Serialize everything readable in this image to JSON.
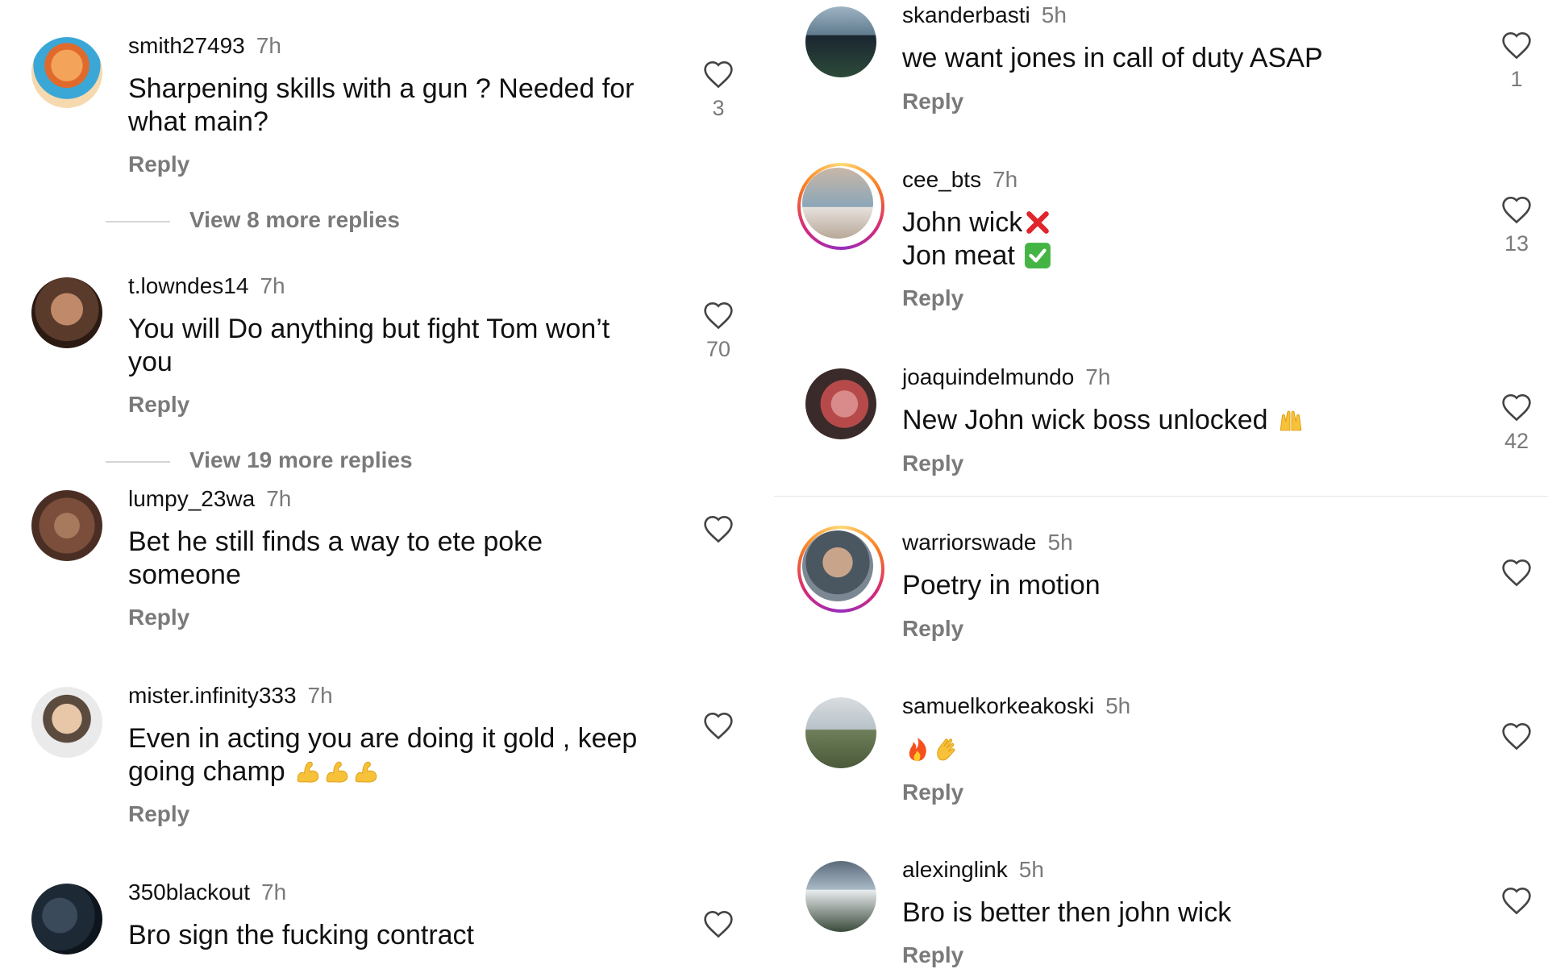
{
  "left_comments": [
    {
      "username": "smith27493",
      "time": "7h",
      "text": "Sharpening skills with a gun ? Needed for what main?",
      "likes": "3",
      "reply": "Reply",
      "view_more": "View 8 more replies"
    },
    {
      "username": "t.lowndes14",
      "time": "7h",
      "text": "You will Do anything but fight Tom won’t you",
      "likes": "70",
      "reply": "Reply",
      "view_more": "View 19 more replies"
    },
    {
      "username": "lumpy_23wa",
      "time": "7h",
      "text": "Bet he still finds a way to ete poke someone",
      "likes": "",
      "reply": "Reply"
    },
    {
      "username": "mister.infinity333",
      "time": "7h",
      "text": "Even in acting you are doing it gold , keep going champ",
      "emoji": "flexed-biceps-x3",
      "likes": "",
      "reply": "Reply"
    },
    {
      "username": "350blackout",
      "time": "7h",
      "text": "Bro sign the fucking contract",
      "likes": "",
      "reply": "Reply"
    }
  ],
  "right_comments": [
    {
      "username": "skanderbasti",
      "time": "5h",
      "text": "we want jones in call of duty ASAP",
      "likes": "1",
      "reply": "Reply"
    },
    {
      "username": "cee_bts",
      "time": "7h",
      "text_line1": "John wick",
      "emoji_line1": "red-cross-mark",
      "text_line2": "Jon meat",
      "emoji_line2": "green-check-mark",
      "likes": "13",
      "reply": "Reply",
      "has_story_ring": true
    },
    {
      "username": "joaquindelmundo",
      "time": "7h",
      "text": "New John wick boss unlocked",
      "emoji": "raising-hands",
      "likes": "42",
      "reply": "Reply"
    },
    {
      "username": "warriorswade",
      "time": "5h",
      "text": "Poetry in motion",
      "likes": "",
      "reply": "Reply",
      "has_story_ring": true
    },
    {
      "username": "samuelkorkeakoski",
      "time": "5h",
      "text": "",
      "emoji": "fire-clap",
      "likes": "",
      "reply": "Reply"
    },
    {
      "username": "alexinglink",
      "time": "5h",
      "text": "Bro is better then john wick",
      "likes": "",
      "reply": "Reply"
    }
  ],
  "colors": {
    "text": "#111111",
    "muted": "#7a7a7a",
    "divider": "#e6e6e6"
  }
}
